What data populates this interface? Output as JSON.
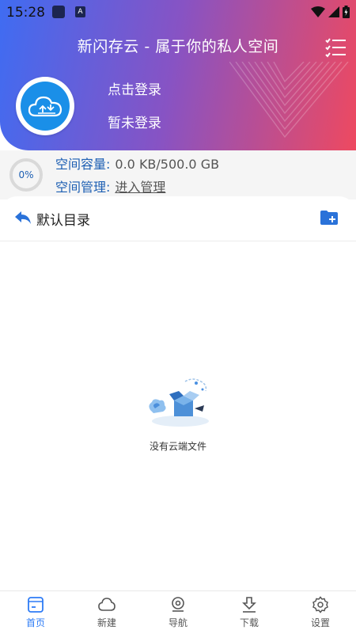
{
  "statusbar": {
    "time": "15:28",
    "a_badge": "A"
  },
  "header": {
    "title": "新闪存云 - 属于你的私人空间",
    "login_text": "点击登录",
    "login_status": "暂未登录"
  },
  "storage": {
    "percent_text": "0%",
    "usage_fraction": 0.0,
    "capacity_label": "空间容量:",
    "capacity_value": "0.0 KB/500.0 GB",
    "manage_label": "空间管理:",
    "manage_link": "进入管理"
  },
  "directory": {
    "name": "默认目录"
  },
  "empty_state": {
    "text": "没有云端文件"
  },
  "bottom_nav": [
    {
      "label": "首页",
      "icon": "home-icon",
      "active": true
    },
    {
      "label": "新建",
      "icon": "cloud-icon",
      "active": false
    },
    {
      "label": "导航",
      "icon": "navigation-icon",
      "active": false
    },
    {
      "label": "下载",
      "icon": "download-icon",
      "active": false
    },
    {
      "label": "设置",
      "icon": "settings-icon",
      "active": false
    }
  ],
  "colors": {
    "gradient_start": "#3f6cf2",
    "gradient_mid": "#8753c4",
    "gradient_end": "#ee4960",
    "accent_blue": "#1d5fb3",
    "nav_active": "#2e7cf6"
  }
}
